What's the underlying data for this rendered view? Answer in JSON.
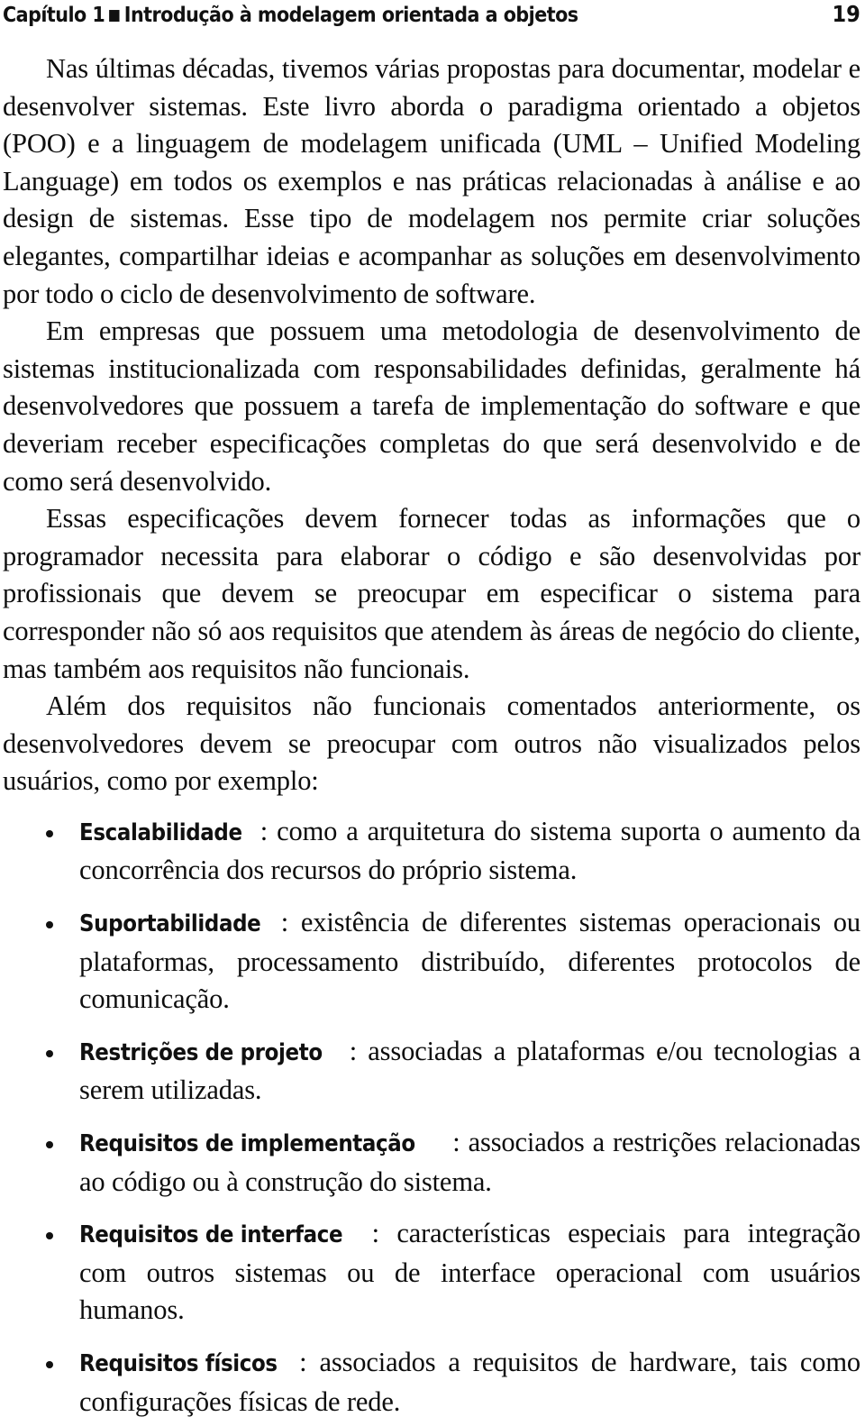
{
  "header": {
    "chapter_label": "Capítulo 1",
    "chapter_mark": "■",
    "chapter_title": "Introdução à modelagem orientada a objetos",
    "full_title": "Capítulo 1 ■ Introdução à modelagem orientada a objetos",
    "page_number": "19"
  },
  "colors": {
    "text": "#0d0d0d",
    "heading": "#111111",
    "background": "#ffffff"
  },
  "body": {
    "paragraphs": [
      "Nas últimas décadas, tivemos várias propostas para documentar, modelar e desenvolver sistemas. Este livro aborda o paradigma orientado a objetos (POO) e a linguagem de modelagem unificada (UML – Unified Modeling Language) em todos os exemplos e nas práticas relacionadas à análise e ao design de sistemas. Esse tipo de modelagem nos permite criar soluções elegantes, compartilhar ideias e acompanhar as soluções em desenvolvimento por todo o ciclo de desenvolvimento de software.",
      "Em empresas que possuem uma metodologia de desenvolvimento de sistemas institucionalizada com responsabilidades definidas, geralmente há desenvolvedores que possuem a tarefa de implementação do software e que deveriam receber especificações completas do que será desenvolvido e de como será desenvolvido.",
      "Essas especificações devem fornecer todas as informações que o programador necessita para elaborar o código e são desenvolvidas por profissionais que devem se preocupar em especificar o sistema para corresponder não só aos requisitos que atendem às áreas de negócio do cliente, mas também aos requisitos não funcionais.",
      "Além dos requisitos não funcionais comentados anteriormente, os desenvolvedores devem se preocupar com outros não visualizados pelos usuários, como por exemplo:"
    ]
  },
  "requirements_list": {
    "bullet_glyph": "•",
    "items": [
      {
        "term": "Escalabilidade",
        "separator": ": ",
        "description": "como a arquitetura do sistema suporta o aumento da concorrência dos recursos do próprio sistema."
      },
      {
        "term": "Suportabilidade",
        "separator": ": ",
        "description": "existência de diferentes sistemas operacionais ou plataformas, processamento distribuído, diferentes protocolos de comunicação."
      },
      {
        "term": "Restrições de projeto",
        "separator": ": ",
        "description": "associadas a plataformas e/ou tecnologias a serem utilizadas."
      },
      {
        "term": "Requisitos de implementação",
        "separator": ": ",
        "description": "associados a restrições relacionadas ao código ou à construção do sistema."
      },
      {
        "term": "Requisitos de interface",
        "separator": ": ",
        "description": "características especiais para integração com outros sistemas ou de interface operacional com usuários humanos."
      },
      {
        "term": "Requisitos físicos",
        "separator": ": ",
        "description": "associados a requisitos de hardware, tais como configurações físicas de rede."
      }
    ]
  }
}
